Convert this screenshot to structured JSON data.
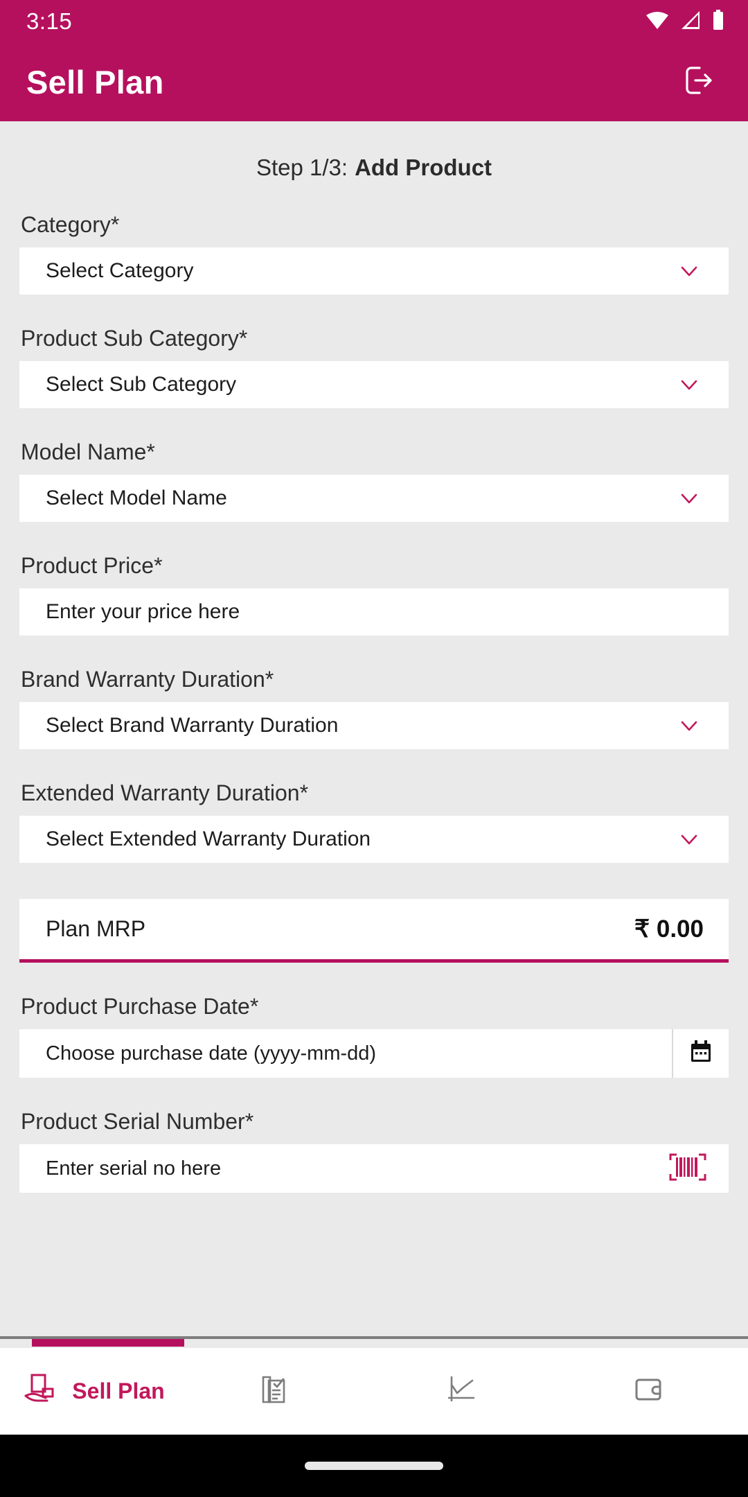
{
  "colors": {
    "brand": "#b5105e",
    "accent": "#c2185b",
    "background": "#eaeaea",
    "field": "#ffffff",
    "text": "#1c1c1c",
    "nav_inactive": "#7d7d7d"
  },
  "status_bar": {
    "time": "3:15",
    "icons": [
      "wifi-icon",
      "signal-icon",
      "battery-icon"
    ]
  },
  "app_bar": {
    "title": "Sell Plan",
    "logout_icon": "logout-icon"
  },
  "step": {
    "prefix": "Step 1/3:",
    "name": "Add Product"
  },
  "fields": [
    {
      "label": "Category*",
      "placeholder": "Select Category",
      "type": "dropdown",
      "name": "category"
    },
    {
      "label": "Product Sub Category*",
      "placeholder": "Select Sub Category",
      "type": "dropdown",
      "name": "sub-category"
    },
    {
      "label": "Model Name*",
      "placeholder": "Select Model Name",
      "type": "dropdown",
      "name": "model-name"
    },
    {
      "label": "Product Price*",
      "placeholder": "Enter your price here",
      "type": "text",
      "name": "product-price"
    },
    {
      "label": "Brand Warranty Duration*",
      "placeholder": "Select Brand Warranty Duration",
      "type": "dropdown",
      "name": "brand-warranty-duration"
    },
    {
      "label": "Extended Warranty Duration*",
      "placeholder": "Select Extended Warranty Duration",
      "type": "dropdown",
      "name": "extended-warranty-duration"
    }
  ],
  "mrp": {
    "label": "Plan MRP",
    "value": "₹ 0.00"
  },
  "purchase_date": {
    "label": "Product Purchase Date*",
    "placeholder": "Choose purchase date (yyyy-mm-dd)",
    "icon": "calendar-icon"
  },
  "serial": {
    "label": "Product Serial Number*",
    "placeholder": "Enter serial no here",
    "icon": "barcode-scan-icon"
  },
  "bottom_nav": [
    {
      "label": "Sell Plan",
      "icon": "hand-holding-card-icon",
      "active": true
    },
    {
      "label": "",
      "icon": "document-check-icon",
      "active": false
    },
    {
      "label": "",
      "icon": "line-chart-icon",
      "active": false
    },
    {
      "label": "",
      "icon": "wallet-icon",
      "active": false
    }
  ]
}
